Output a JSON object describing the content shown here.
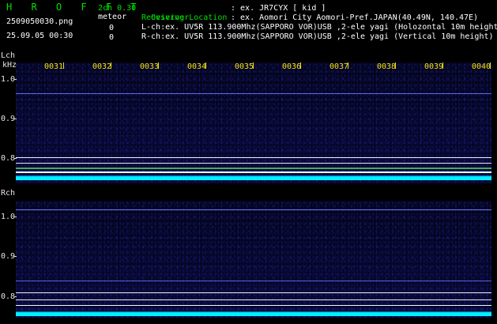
{
  "app": {
    "title": "H R O F F T",
    "version": "2ch 0.30",
    "file_name": "2509050030.png",
    "timestamp": "25.09.05 00:30",
    "meteor_label": "meteor",
    "meteor_counts": [
      "0",
      "0"
    ]
  },
  "metadata": {
    "observer_label": "Ovserver",
    "observer_value": ": ex. JR7CYX [ kid ]",
    "location_label": "Receiving Location",
    "location_value": ": ex. Aomori City Aomori-Pref.JAPAN(40.49N, 140.47E)",
    "lch": "L-ch:ex. UV5R 113.900Mhz(SAPPORO VOR)USB ,2-ele yagi (Holozontal 10m height)",
    "rch": "R-ch:ex. UV5R 113.900Mhz(SAPPORO VOR)USB ,2-ele yagi (Vertical 10m height)"
  },
  "axis": {
    "lch_label": "Lch",
    "khz_label": "kHz",
    "rch_label": "Rch",
    "frequency_ticks": [
      "1.0",
      "0.9",
      "0.8"
    ],
    "minutes": [
      "0031",
      "0032",
      "0033",
      "0034",
      "0035",
      "0036",
      "0037",
      "0038",
      "0039",
      "0040"
    ]
  },
  "colors": {
    "background": "#000000",
    "title_green": "#00e000",
    "minute_yellow": "#f0e000",
    "signal_cyan": "#00f0ff",
    "noise_blue": "#2f3fc8"
  }
}
